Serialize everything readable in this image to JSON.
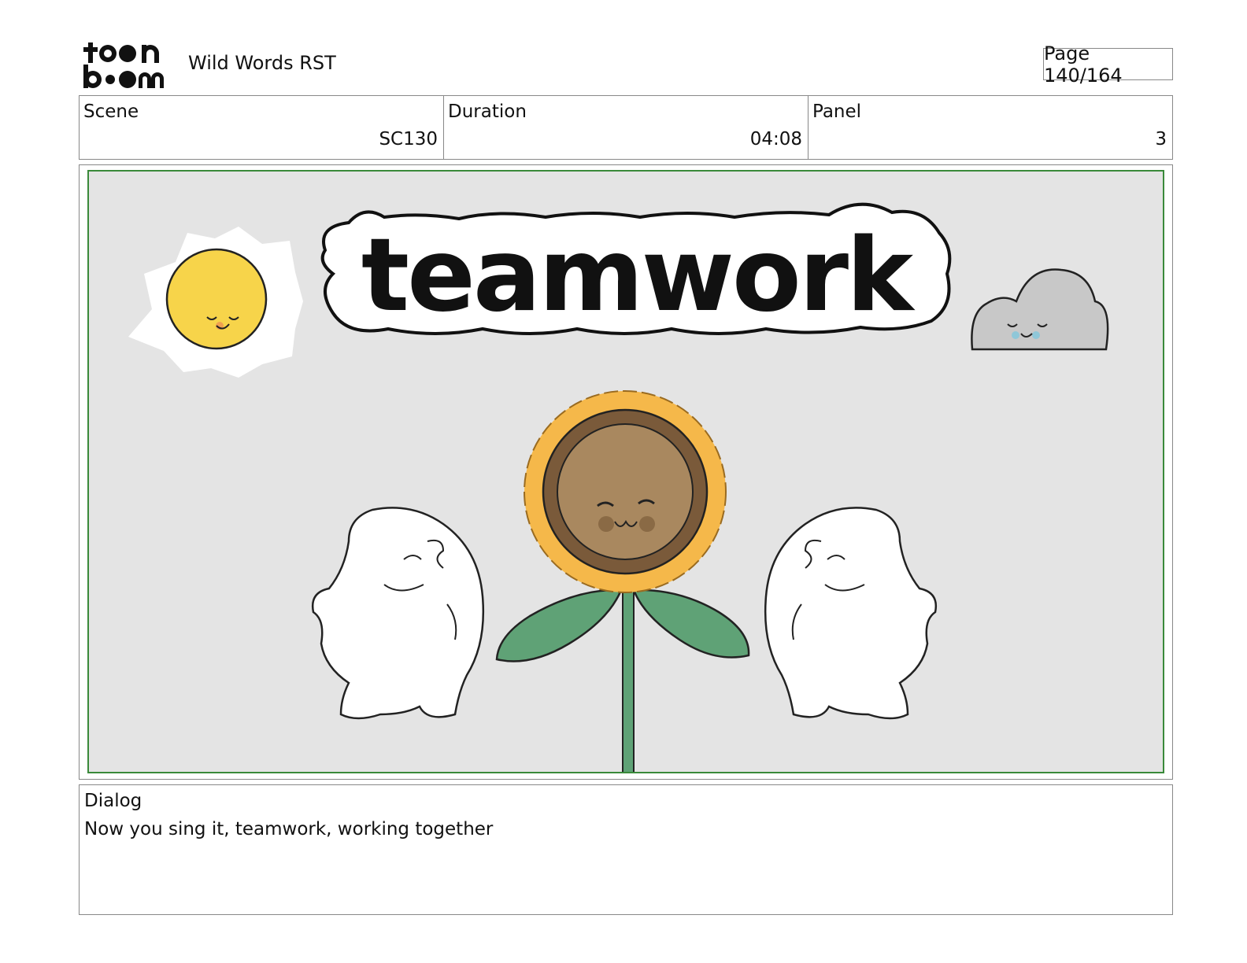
{
  "header": {
    "logo_text": "toon boom",
    "project_title": "Wild Words RST",
    "page_label": "Page 140/164"
  },
  "info": {
    "scene_label": "Scene",
    "scene_value": "SC130",
    "duration_label": "Duration",
    "duration_value": "04:08",
    "panel_label": "Panel",
    "panel_value": "3"
  },
  "artwork": {
    "headline": "teamwork",
    "colors": {
      "background": "#e4e4e4",
      "frame_border": "#3a8a3a",
      "sun": "#f7d44a",
      "cloud": "#c8c8c8",
      "petals": "#f5b84a",
      "seed_disc": "#a9885f",
      "leaves": "#5fa276"
    }
  },
  "dialog": {
    "label": "Dialog",
    "text": "Now you sing it, teamwork, working together"
  }
}
